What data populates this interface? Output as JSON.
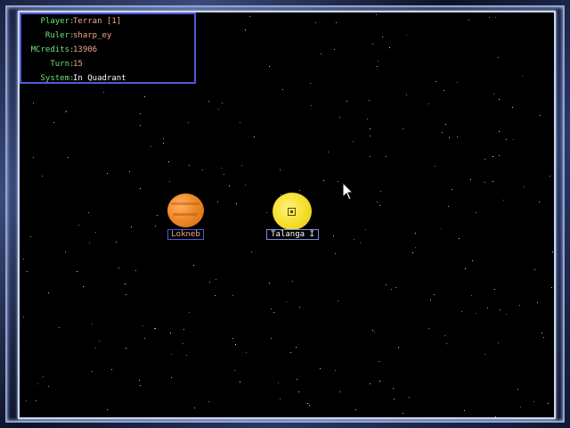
{
  "info_panel": {
    "rows": [
      {
        "label": "Player",
        "value": "Terran [1]"
      },
      {
        "label": "Ruler",
        "value": "sharp_ey"
      },
      {
        "label": "MCredits",
        "value": "13906"
      },
      {
        "label": "Turn",
        "value": "15"
      },
      {
        "label": "System",
        "value": "In Quadrant"
      }
    ]
  },
  "planets": [
    {
      "name": "Lokneb",
      "color": "#f08a28"
    },
    {
      "name": "Talanga I",
      "color": "#f6e02e"
    }
  ],
  "colors": {
    "label_green": "#6ee37a",
    "value_salmon": "#f2a58a",
    "panel_border": "#4f5bd8",
    "frame_line": "#c9d6f5"
  },
  "icons": {
    "cursor": "arrow-cursor-icon",
    "selection": "selection-square-icon"
  }
}
